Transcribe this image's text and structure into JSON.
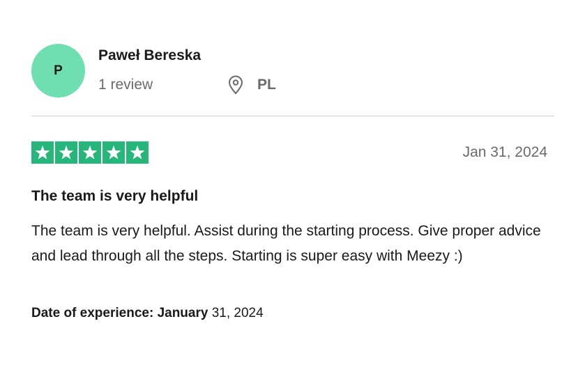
{
  "reviewer": {
    "initial": "P",
    "name": "Paweł Bereska",
    "review_count": "1 review",
    "location_icon": "map-pin-icon",
    "country": "PL"
  },
  "review": {
    "rating": 5,
    "rating_max": 5,
    "star_color": "#27b67a",
    "avatar_color": "#6fdeb0",
    "date": "Jan 31, 2024",
    "title": "The team is very helpful",
    "body": "The team is very helpful. Assist during the starting process. Give proper advice and lead through all the steps. Starting is super easy with Meezy :)",
    "experience_label": "Date of experience: January",
    "experience_date": "31, 2024"
  }
}
